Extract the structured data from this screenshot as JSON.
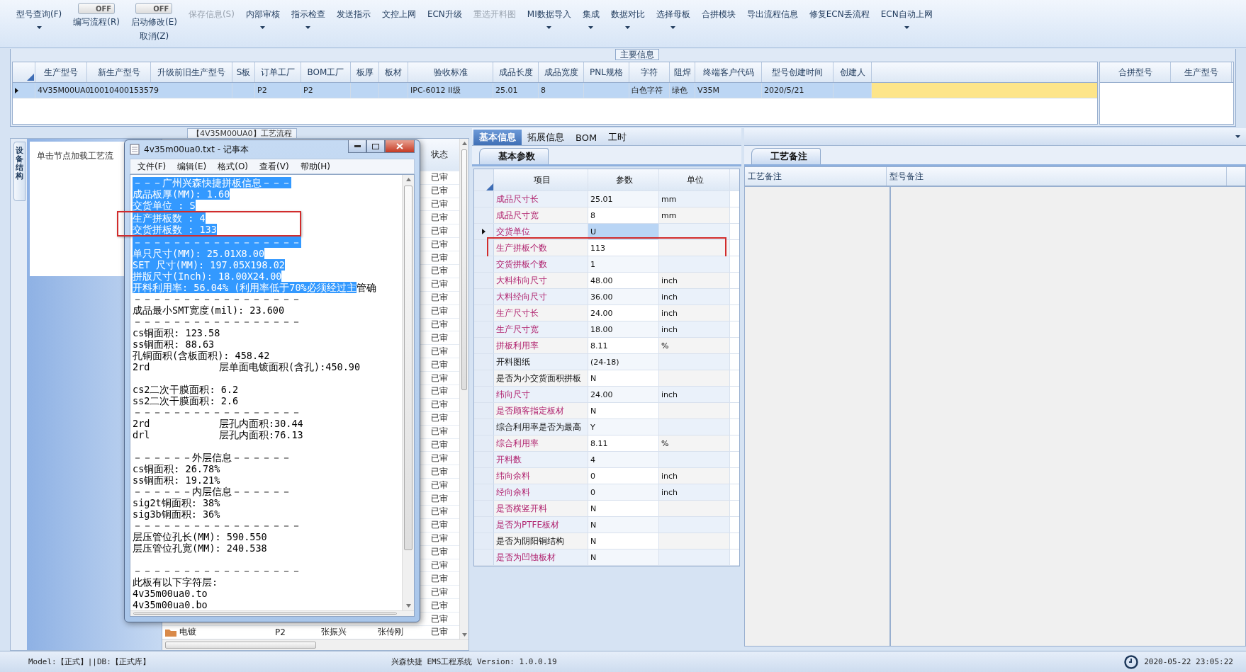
{
  "toolbar": {
    "items": [
      {
        "kind": "button",
        "label": "型号查询(F)",
        "menu": true,
        "disabled": false
      },
      {
        "kind": "toggle",
        "switch": "OFF",
        "on": false,
        "label": "编写流程(R)"
      },
      {
        "kind": "toggle",
        "switch": "OFF",
        "on": false,
        "label": "启动修改(E)",
        "label2": "取消(Z)"
      },
      {
        "kind": "button",
        "label": "保存信息(S)",
        "menu": false,
        "disabled": true
      },
      {
        "kind": "button",
        "label": "内部审核",
        "menu": true,
        "disabled": false
      },
      {
        "kind": "button",
        "label": "指示检查",
        "menu": true,
        "disabled": false
      },
      {
        "kind": "button",
        "label": "发送指示",
        "menu": false,
        "disabled": false
      },
      {
        "kind": "button",
        "label": "文控上网",
        "menu": false,
        "disabled": false
      },
      {
        "kind": "button",
        "label": "ECN升级",
        "menu": false,
        "disabled": false
      },
      {
        "kind": "button",
        "label": "重选开料图",
        "menu": false,
        "disabled": true
      },
      {
        "kind": "button",
        "label": "MI数据导入",
        "menu": true,
        "disabled": false
      },
      {
        "kind": "button",
        "label": "集成",
        "menu": true,
        "disabled": false
      },
      {
        "kind": "button",
        "label": "数据对比",
        "menu": true,
        "disabled": false
      },
      {
        "kind": "button",
        "label": "选择母板",
        "menu": true,
        "disabled": false
      },
      {
        "kind": "button",
        "label": "合拼模块",
        "menu": false,
        "disabled": false
      },
      {
        "kind": "button",
        "label": "导出流程信息",
        "menu": false,
        "disabled": false
      },
      {
        "kind": "button",
        "label": "修复ECN丢流程",
        "menu": false,
        "disabled": false
      },
      {
        "kind": "button",
        "label": "ECN自动上网",
        "menu": true,
        "disabled": false
      }
    ]
  },
  "main_info": {
    "title": "主要信息",
    "table": {
      "columns": [
        "生产型号",
        "新生产型号",
        "升级前旧生产型号",
        "S板",
        "订单工厂",
        "BOM工厂",
        "板厚",
        "板材",
        "验收标准",
        "成品长度",
        "成品宽度",
        "PNL规格",
        "字符",
        "阻焊",
        "终端客户代码",
        "型号创建时间",
        "创建人"
      ],
      "rows": [
        {
          "selected": true,
          "cells": [
            "4V35M00UA0",
            "10010400153579",
            null,
            null,
            "P2",
            "P2",
            null,
            null,
            "IPC-6012 II级",
            "25.01",
            "8",
            null,
            "白色字符",
            "绿色",
            "V35M",
            "2020/5/21",
            null
          ]
        }
      ]
    },
    "merge_table": {
      "columns": [
        "合拼型号",
        "生产型号"
      ]
    }
  },
  "process_panel": {
    "title": "【4V35M00UA0】工艺流程",
    "side_tab": "设备结构",
    "hint": "单击节点加载工艺流",
    "status_header": "状态",
    "rows": [
      {
        "status": "已审"
      },
      {
        "status": "已审"
      },
      {
        "status": "已审"
      },
      {
        "status": "已审"
      },
      {
        "status": "已审"
      },
      {
        "status": "已审"
      },
      {
        "status": "已审"
      },
      {
        "status": "已审"
      },
      {
        "status": "已审"
      },
      {
        "status": "已审"
      },
      {
        "status": "已审"
      },
      {
        "status": "已审"
      },
      {
        "status": "已审"
      },
      {
        "status": "已审"
      },
      {
        "status": "已审"
      },
      {
        "status": "已审"
      },
      {
        "status": "已审"
      },
      {
        "status": "已审"
      },
      {
        "status": "已审"
      },
      {
        "status": "已审"
      },
      {
        "status": "已审"
      },
      {
        "status": "已审"
      },
      {
        "status": "已审"
      },
      {
        "status": "已审"
      },
      {
        "status": "已审"
      },
      {
        "status": "已审"
      },
      {
        "status": "已审"
      },
      {
        "status": "已审"
      },
      {
        "status": "已审"
      },
      {
        "status": "已审"
      },
      {
        "status": "已审"
      },
      {
        "status": "已审"
      },
      {
        "status": "已审"
      },
      {
        "status": "已审"
      },
      {
        "status": "已审",
        "cells": [
          "电镀",
          "P2",
          "张振兴",
          "张传刚"
        ]
      }
    ]
  },
  "notepad": {
    "title": "4v35m00ua0.txt - 记事本",
    "menu": [
      "文件(F)",
      "编辑(E)",
      "格式(O)",
      "查看(V)",
      "帮助(H)"
    ],
    "blocks": [
      [
        {
          "text": "－－－广州兴森快捷拼板信息－－－",
          "selected": true,
          "marked": false
        },
        {
          "text": "成品板厚(MM): 1.60",
          "selected": true,
          "marked": false
        },
        {
          "text": "交货单位 : S",
          "selected": true,
          "marked": false
        },
        {
          "text": "生产拼板数 : 4",
          "selected": true,
          "marked": true
        },
        {
          "text": "交货拼板数 : 133",
          "selected": true,
          "marked": true
        },
        {
          "text": "－－－－－－－－－－－－－－－－－",
          "selected": true,
          "marked": false
        },
        {
          "text": "单只尺寸(MM): 25.01X8.00",
          "selected": true,
          "marked": false
        },
        {
          "text": "SET 尺寸(MM): 197.05X198.02",
          "selected": true,
          "marked": false
        },
        {
          "text": "拼版尺寸(Inch): 18.00X24.00",
          "selected": true,
          "marked": false
        },
        {
          "text": "开料利用率: 56.04% (利用率低于70%必须经过主",
          "tail": "管确",
          "selected": true,
          "marked": false
        },
        {
          "text": "－－－－－－－－－－－－－－－－－",
          "selected": false,
          "marked": false
        },
        {
          "text": "成品最小SMT宽度(mil): 23.600",
          "selected": false,
          "marked": false
        },
        {
          "text": "－－－－－－－－－－－－－－－－－",
          "selected": false,
          "marked": false
        },
        {
          "text": "cs铜面积: 123.58",
          "selected": false,
          "marked": false
        },
        {
          "text": "ss铜面积: 88.63",
          "selected": false,
          "marked": false
        },
        {
          "text": "孔铜面积(含板面积): 458.42",
          "selected": false,
          "marked": false
        },
        {
          "text": "2rd            层单面电镀面积(含孔):450.90",
          "selected": false,
          "marked": false
        }
      ],
      [
        {
          "text": "cs2二次干膜面积: 6.2",
          "selected": false,
          "marked": false
        },
        {
          "text": "ss2二次干膜面积: 2.6",
          "selected": false,
          "marked": false
        },
        {
          "text": "－－－－－－－－－－－－－－－－－",
          "selected": false,
          "marked": false
        },
        {
          "text": "2rd            层孔内面积:30.44",
          "selected": false,
          "marked": false
        },
        {
          "text": "drl            层孔内面积:76.13",
          "selected": false,
          "marked": false
        }
      ],
      [
        {
          "text": "－－－－－－外层信息－－－－－－",
          "selected": false,
          "marked": false
        },
        {
          "text": "cs铜面积: 26.78%",
          "selected": false,
          "marked": false
        },
        {
          "text": "ss铜面积: 19.21%",
          "selected": false,
          "marked": false
        },
        {
          "text": "－－－－－－内层信息－－－－－－",
          "selected": false,
          "marked": false
        },
        {
          "text": "sig2t铜面积: 38%",
          "selected": false,
          "marked": false
        },
        {
          "text": "sig3b铜面积: 36%",
          "selected": false,
          "marked": false
        },
        {
          "text": "－－－－－－－－－－－－－－－－－",
          "selected": false,
          "marked": false
        },
        {
          "text": "层压管位孔长(MM): 590.550",
          "selected": false,
          "marked": false
        },
        {
          "text": "层压管位孔宽(MM): 240.538",
          "selected": false,
          "marked": false
        }
      ],
      [
        {
          "text": "－－－－－－－－－－－－－－－－－",
          "selected": false,
          "marked": false
        },
        {
          "text": "此板有以下字符层:",
          "selected": false,
          "marked": false
        },
        {
          "text": "4v35m00ua0.to",
          "selected": false,
          "marked": false
        },
        {
          "text": "4v35m00ua0.bo",
          "selected": false,
          "marked": false
        }
      ]
    ]
  },
  "detail_panel": {
    "tabs": [
      {
        "label": "基本信息",
        "selected": true
      },
      {
        "label": "拓展信息",
        "selected": false
      },
      {
        "label": "BOM",
        "selected": false
      },
      {
        "label": "工时",
        "selected": false
      }
    ],
    "subtab": "基本参数",
    "columns": [
      "项目",
      "参数",
      "单位"
    ],
    "rows": [
      {
        "name": "成品尺寸长",
        "value": "25.01",
        "unit": "mm",
        "emphasized": true,
        "selected": false,
        "marked": false
      },
      {
        "name": "成品尺寸宽",
        "value": "8",
        "unit": "mm",
        "emphasized": true,
        "selected": false,
        "marked": false
      },
      {
        "name": "交货单位",
        "value": "U",
        "emphasized": true,
        "selected": true,
        "marked": false
      },
      {
        "name": "生产拼板个数",
        "value": "113",
        "emphasized": true,
        "selected": false,
        "marked": true
      },
      {
        "name": "交货拼板个数",
        "value": "1",
        "emphasized": true,
        "selected": false,
        "marked": false
      },
      {
        "name": "大料纬向尺寸",
        "value": "48.00",
        "unit": "inch",
        "emphasized": true,
        "selected": false,
        "marked": false
      },
      {
        "name": "大料经向尺寸",
        "value": "36.00",
        "unit": "inch",
        "emphasized": true,
        "selected": false,
        "marked": false
      },
      {
        "name": "生产尺寸长",
        "value": "24.00",
        "unit": "inch",
        "emphasized": true,
        "selected": false,
        "marked": false
      },
      {
        "name": "生产尺寸宽",
        "value": "18.00",
        "unit": "inch",
        "emphasized": true,
        "selected": false,
        "marked": false
      },
      {
        "name": "拼板利用率",
        "value": "8.11",
        "unit": "%",
        "emphasized": true,
        "selected": false,
        "marked": false
      },
      {
        "name": "开料图纸",
        "value": "(24-18)",
        "emphasized": false,
        "selected": false,
        "marked": false
      },
      {
        "name": "是否为小交货面积拼板",
        "value": "N",
        "emphasized": false,
        "selected": false,
        "marked": false
      },
      {
        "name": "纬向尺寸",
        "value": "24.00",
        "unit": "inch",
        "emphasized": true,
        "selected": false,
        "marked": false
      },
      {
        "name": "是否顾客指定板材",
        "value": "N",
        "emphasized": true,
        "selected": false,
        "marked": false
      },
      {
        "name": "综合利用率是否为最高",
        "value": "Y",
        "emphasized": false,
        "selected": false,
        "marked": false
      },
      {
        "name": "综合利用率",
        "value": "8.11",
        "unit": "%",
        "emphasized": true,
        "selected": false,
        "marked": false
      },
      {
        "name": "开料数",
        "value": "4",
        "emphasized": true,
        "selected": false,
        "marked": false
      },
      {
        "name": "纬向余料",
        "value": "0",
        "unit": "inch",
        "emphasized": true,
        "selected": false,
        "marked": false
      },
      {
        "name": "经向余料",
        "value": "0",
        "unit": "inch",
        "emphasized": true,
        "selected": false,
        "marked": false
      },
      {
        "name": "是否横竖开料",
        "value": "N",
        "emphasized": true,
        "selected": false,
        "marked": false
      },
      {
        "name": "是否为PTFE板材",
        "value": "N",
        "emphasized": true,
        "selected": false,
        "marked": false
      },
      {
        "name": "是否为阴阳铜结构",
        "value": "N",
        "emphasized": false,
        "selected": false,
        "marked": false
      },
      {
        "name": "是否为凹蚀板材",
        "value": "N",
        "emphasized": true,
        "selected": false,
        "marked": false
      }
    ]
  },
  "notes_panel": {
    "tab": "工艺备注",
    "columns": [
      "工艺备注",
      "型号备注"
    ]
  },
  "status_bar": {
    "model": "Model:【正式】||DB:【正式库】",
    "app": "兴森快捷 EMS工程系统 Version: 1.0.0.19",
    "time": "2020-05-22 23:05:22"
  }
}
